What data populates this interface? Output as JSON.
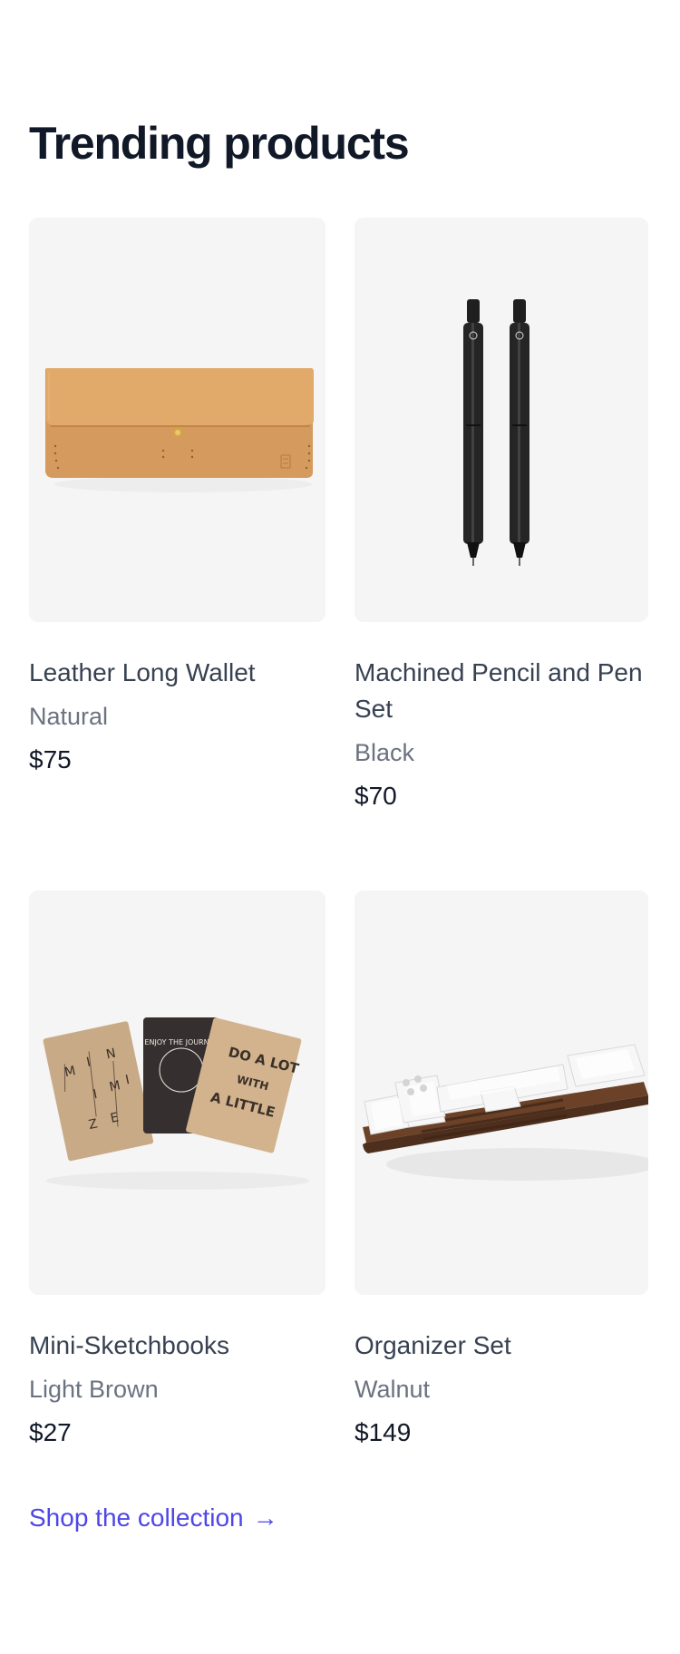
{
  "section": {
    "title": "Trending products"
  },
  "products": [
    {
      "name": "Leather Long Wallet",
      "color": "Natural",
      "price": "$75",
      "image": "leather-wallet-image"
    },
    {
      "name": "Machined Pencil and Pen Set",
      "color": "Black",
      "price": "$70",
      "image": "pencil-pen-set-image"
    },
    {
      "name": "Mini-Sketchbooks",
      "color": "Light Brown",
      "price": "$27",
      "image": "mini-sketchbooks-image"
    },
    {
      "name": "Organizer Set",
      "color": "Walnut",
      "price": "$149",
      "image": "organizer-set-image"
    }
  ],
  "sketchbooks": {
    "left_letters": [
      "M",
      "I",
      "N",
      "I",
      "M",
      "I",
      "Z",
      "E"
    ],
    "middle_ring": "ENJOY THE JOURNEY",
    "right_lines": [
      "DO A LOT",
      "WITH",
      "A LITTLE"
    ]
  },
  "cta": {
    "label": "Shop the collection",
    "arrow": "→"
  },
  "colors": {
    "title": "#111827",
    "product_name": "#374151",
    "secondary_text": "#6b7280",
    "price": "#111827",
    "link": "#4f46e5",
    "image_background": "#f5f5f5"
  }
}
